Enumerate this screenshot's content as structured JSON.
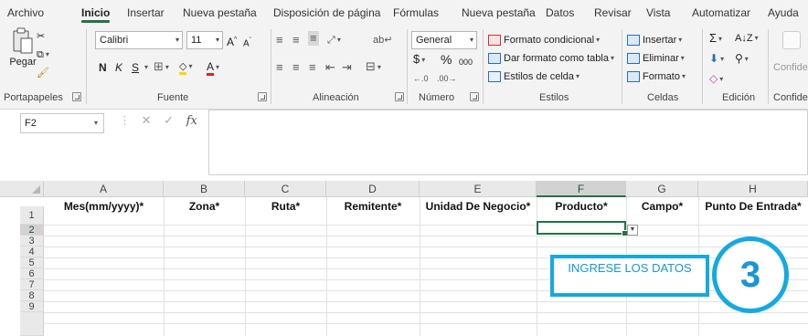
{
  "menu": {
    "tabs": [
      "Archivo",
      "Inicio",
      "Insertar",
      "Nueva pestaña",
      "Disposición de página",
      "Fórmulas",
      "Nueva pestaña",
      "Datos",
      "Revisar",
      "Vista",
      "Automatizar",
      "Ayuda"
    ],
    "active_tab": "Inicio"
  },
  "ribbon": {
    "clipboard": {
      "paste_label": "Pegar",
      "group_label": "Portapapeles"
    },
    "font": {
      "font_name": "Calibri",
      "font_size": "11",
      "bold": "N",
      "italic": "K",
      "underline": "S",
      "group_label": "Fuente"
    },
    "alignment": {
      "group_label": "Alineación"
    },
    "number": {
      "format": "General",
      "currency": "$",
      "percent": "%",
      "thousands": "000",
      "group_label": "Número"
    },
    "styles": {
      "conditional": "Formato condicional",
      "as_table": "Dar formato como tabla",
      "cell_styles": "Estilos de celda",
      "group_label": "Estilos"
    },
    "cells": {
      "insert": "Insertar",
      "delete": "Eliminar",
      "format": "Formato",
      "group_label": "Celdas"
    },
    "editing": {
      "group_label": "Edición"
    },
    "extra": {
      "label": "Confide",
      "group_label": "Confide"
    }
  },
  "formula_bar": {
    "name_box": "F2",
    "fx": "fx",
    "value": ""
  },
  "grid": {
    "columns": [
      "A",
      "B",
      "C",
      "D",
      "E",
      "F",
      "G",
      "H"
    ],
    "selected_column": "F",
    "rows": [
      "1",
      "2",
      "3",
      "4",
      "5",
      "6",
      "7",
      "8",
      "9"
    ],
    "selected_row": "2",
    "headers": [
      "Mes(mm/yyyy)*",
      "Zona*",
      "Ruta*",
      "Remitente*",
      "Unidad De Negocio*",
      "Producto*",
      "Campo*",
      "Punto De Entrada*"
    ],
    "active_cell": "F2"
  },
  "annotation": {
    "callout_text": "INGRESE LOS DATOS",
    "step_number": "3",
    "color": "#16a9e1"
  },
  "colors": {
    "accent": "#217346",
    "ribbon_bg": "#f3f3f3"
  }
}
